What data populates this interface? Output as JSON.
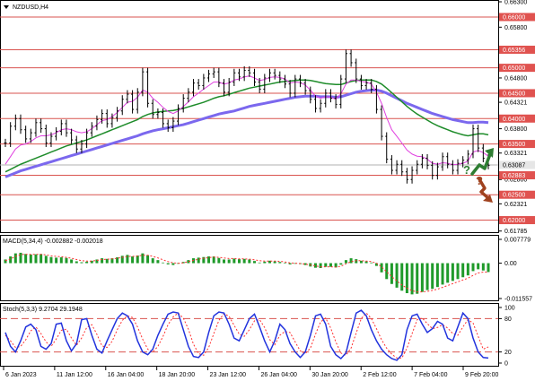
{
  "chart_data": [
    {
      "type": "line",
      "title": "NZDUSD,H4",
      "ylim": [
        0.6178,
        0.663
      ],
      "y_ticks": [
        "0.66300",
        "0.65800",
        "0.65356",
        "0.64800",
        "0.64321",
        "0.63800",
        "0.63321",
        "0.62800",
        "0.62321",
        "0.61785"
      ],
      "levels": [
        "0.66000",
        "0.65356",
        "0.65000",
        "0.64500",
        "0.64000",
        "0.63500",
        "0.62883",
        "0.62500",
        "0.62000"
      ],
      "current_price": "0.63087",
      "current_price_value": 0.63087,
      "x_labels": [
        "6 Jan 2023",
        "11 Jan 12:00",
        "16 Jan 04:00",
        "18 Jan 20:00",
        "23 Jan 12:00",
        "26 Jan 04:00",
        "30 Jan 20:00",
        "2 Feb 12:00",
        "7 Feb 04:00",
        "9 Feb 20:00"
      ],
      "series": [
        {
          "values": [
            0.6352,
            0.6385,
            0.64,
            0.6378,
            0.636,
            0.6372,
            0.6392,
            0.638,
            0.6352,
            0.6365,
            0.6375,
            0.639,
            0.6372,
            0.6358,
            0.634,
            0.635,
            0.6372,
            0.6385,
            0.6398,
            0.641,
            0.639,
            0.6402,
            0.6415,
            0.6438,
            0.6448,
            0.6418,
            0.6452,
            0.6492,
            0.643,
            0.6408,
            0.6412,
            0.639,
            0.6382,
            0.6395,
            0.642,
            0.644,
            0.6452,
            0.647,
            0.6465,
            0.648,
            0.6488,
            0.6492,
            0.647,
            0.6452,
            0.6472,
            0.649,
            0.6482,
            0.6495,
            0.649,
            0.6472,
            0.6458,
            0.648,
            0.649,
            0.6485,
            0.6478,
            0.6468,
            0.645,
            0.6478,
            0.647,
            0.6455,
            0.6438,
            0.642,
            0.643,
            0.645,
            0.644,
            0.6428,
            0.6478,
            0.6528,
            0.651,
            0.6478,
            0.6465,
            0.647,
            0.6458,
            0.6418,
            0.6365,
            0.632,
            0.6298,
            0.631,
            0.6295,
            0.628,
            0.6298,
            0.631,
            0.6322,
            0.6308,
            0.6288,
            0.6305,
            0.6325,
            0.631,
            0.6298,
            0.6312,
            0.6318,
            0.633,
            0.638,
            0.6342,
            0.6322,
            0.6308
          ]
        },
        {
          "values": [
            0.631,
            0.6325,
            0.634,
            0.6348,
            0.635,
            0.6355,
            0.6362,
            0.6366,
            0.6366,
            0.6368,
            0.6372,
            0.6378,
            0.638,
            0.6378,
            0.6374,
            0.6372,
            0.6374,
            0.638,
            0.6388,
            0.6396,
            0.6398,
            0.6404,
            0.6412,
            0.6422,
            0.6432,
            0.6434,
            0.6442,
            0.6456,
            0.6452,
            0.644,
            0.6432,
            0.6422,
            0.6414,
            0.641,
            0.6415,
            0.6424,
            0.6433,
            0.6443,
            0.645,
            0.6458,
            0.6465,
            0.6472,
            0.6472,
            0.6468,
            0.647,
            0.6476,
            0.6478,
            0.6482,
            0.6484,
            0.648,
            0.6475,
            0.6477,
            0.6481,
            0.6482,
            0.6481,
            0.6478,
            0.647,
            0.6472,
            0.6471,
            0.6466,
            0.6456,
            0.6444,
            0.644,
            0.6443,
            0.6442,
            0.6438,
            0.6449,
            0.6468,
            0.6476,
            0.6476,
            0.6473,
            0.6472,
            0.6468,
            0.6452,
            0.643,
            0.6402,
            0.6378,
            0.6365,
            0.6352,
            0.6338,
            0.633,
            0.6326,
            0.6325,
            0.632,
            0.6312,
            0.631,
            0.6313,
            0.6312,
            0.6309,
            0.631,
            0.6312,
            0.6316,
            0.6334,
            0.6337,
            0.6333,
            0.6326
          ]
        },
        {
          "values": [
            0.6295,
            0.63,
            0.6305,
            0.631,
            0.6314,
            0.6318,
            0.6322,
            0.6326,
            0.633,
            0.6334,
            0.6338,
            0.6342,
            0.6346,
            0.6349,
            0.6352,
            0.6355,
            0.6358,
            0.6362,
            0.6366,
            0.637,
            0.6374,
            0.6378,
            0.6382,
            0.6386,
            0.639,
            0.6394,
            0.6398,
            0.6404,
            0.6408,
            0.6411,
            0.6413,
            0.6414,
            0.6415,
            0.6416,
            0.6418,
            0.642,
            0.6423,
            0.6426,
            0.6429,
            0.6432,
            0.6436,
            0.644,
            0.6443,
            0.6445,
            0.6448,
            0.6451,
            0.6454,
            0.6457,
            0.646,
            0.6462,
            0.6464,
            0.6466,
            0.6468,
            0.647,
            0.6472,
            0.6473,
            0.6474,
            0.6475,
            0.6476,
            0.6476,
            0.6475,
            0.6473,
            0.6471,
            0.6469,
            0.6468,
            0.6467,
            0.6467,
            0.647,
            0.6473,
            0.6475,
            0.6476,
            0.6476,
            0.6476,
            0.6473,
            0.6468,
            0.646,
            0.6451,
            0.6442,
            0.6433,
            0.6424,
            0.6416,
            0.6409,
            0.6403,
            0.6397,
            0.6391,
            0.6386,
            0.6382,
            0.6378,
            0.6374,
            0.6371,
            0.6368,
            0.6366,
            0.6368,
            0.637,
            0.637,
            0.6368
          ]
        },
        {
          "values": [
            0.6285,
            0.6289,
            0.6293,
            0.6297,
            0.63,
            0.6303,
            0.6306,
            0.6309,
            0.6312,
            0.6315,
            0.6318,
            0.6321,
            0.6324,
            0.6327,
            0.633,
            0.6333,
            0.6336,
            0.6339,
            0.6342,
            0.6345,
            0.6348,
            0.6351,
            0.6354,
            0.6357,
            0.636,
            0.6363,
            0.6366,
            0.637,
            0.6373,
            0.6376,
            0.6378,
            0.638,
            0.6382,
            0.6384,
            0.6386,
            0.6388,
            0.6391,
            0.6394,
            0.6397,
            0.64,
            0.6403,
            0.6406,
            0.6409,
            0.6411,
            0.6413,
            0.6415,
            0.6418,
            0.6421,
            0.6424,
            0.6426,
            0.6428,
            0.643,
            0.6432,
            0.6434,
            0.6436,
            0.6438,
            0.644,
            0.6442,
            0.6443,
            0.6444,
            0.6444,
            0.6444,
            0.6443,
            0.6443,
            0.6443,
            0.6442,
            0.6443,
            0.6446,
            0.6449,
            0.6452,
            0.6454,
            0.6455,
            0.6456,
            0.6456,
            0.6454,
            0.645,
            0.6445,
            0.644,
            0.6435,
            0.643,
            0.6426,
            0.6422,
            0.6418,
            0.6414,
            0.641,
            0.6407,
            0.6404,
            0.6401,
            0.6398,
            0.6396,
            0.6394,
            0.6392,
            0.6392,
            0.6393,
            0.6393,
            0.6392
          ]
        }
      ]
    },
    {
      "type": "bar",
      "title": "MACD(5,34,4) -0.002882 -0.002018",
      "ylim": [
        -0.011557,
        0.007779
      ],
      "y_ticks": [
        "0.007779",
        "0.00",
        "-0.011557"
      ],
      "series": [
        {
          "values": [
            0.0012,
            0.0022,
            0.0032,
            0.0034,
            0.003,
            0.0028,
            0.0029,
            0.003,
            0.0024,
            0.002,
            0.0018,
            0.0019,
            0.0017,
            0.0012,
            0.0006,
            0.0003,
            0.0005,
            0.0008,
            0.0012,
            0.0016,
            0.0014,
            0.0016,
            0.0019,
            0.0024,
            0.0027,
            0.0022,
            0.0025,
            0.0032,
            0.0026,
            0.0016,
            0.001,
            0.0002,
            -0.0004,
            -0.0006,
            -0.0002,
            0.0004,
            0.001,
            0.0016,
            0.0018,
            0.002,
            0.0022,
            0.0022,
            0.0017,
            0.0012,
            0.0012,
            0.0015,
            0.0013,
            0.0014,
            0.0012,
            0.0007,
            0.0002,
            0.0005,
            0.0008,
            0.0006,
            0.0004,
            0.0001,
            -0.0004,
            -0.0002,
            -0.0003,
            -0.0006,
            -0.0011,
            -0.0015,
            -0.0016,
            -0.0012,
            -0.0012,
            -0.0014,
            -0.0005,
            0.001,
            0.0016,
            0.0013,
            0.0008,
            0.0006,
            0.0002,
            -0.0009,
            -0.003,
            -0.0052,
            -0.0068,
            -0.008,
            -0.009,
            -0.0098,
            -0.0102,
            -0.01,
            -0.0094,
            -0.0088,
            -0.0084,
            -0.0078,
            -0.007,
            -0.0064,
            -0.0058,
            -0.0052,
            -0.0046,
            -0.004,
            -0.0026,
            -0.002,
            -0.0024,
            -0.0029
          ]
        },
        {
          "values": [
            0.0008,
            0.0014,
            0.0022,
            0.0028,
            0.0029,
            0.0029,
            0.0029,
            0.0029,
            0.0027,
            0.0024,
            0.0022,
            0.0021,
            0.0019,
            0.0016,
            0.0012,
            0.0008,
            0.0007,
            0.0007,
            0.0009,
            0.0012,
            0.0013,
            0.0014,
            0.0016,
            0.0019,
            0.0022,
            0.0022,
            0.0023,
            0.0026,
            0.0026,
            0.0022,
            0.0017,
            0.0011,
            0.0005,
            0.0001,
            0.0,
            0.0001,
            0.0005,
            0.0009,
            0.0013,
            0.0016,
            0.0018,
            0.002,
            0.0019,
            0.0017,
            0.0015,
            0.0015,
            0.0014,
            0.0014,
            0.0013,
            0.0011,
            0.0008,
            0.0007,
            0.0007,
            0.0007,
            0.0006,
            0.0004,
            0.0001,
            0.0,
            -0.0001,
            -0.0003,
            -0.0006,
            -0.0009,
            -0.0012,
            -0.0012,
            -0.0012,
            -0.0013,
            -0.001,
            -0.0002,
            0.0005,
            0.0008,
            0.0008,
            0.0007,
            0.0005,
            0.0,
            -0.0012,
            -0.0028,
            -0.0044,
            -0.0058,
            -0.0071,
            -0.0082,
            -0.009,
            -0.0094,
            -0.0094,
            -0.0092,
            -0.0089,
            -0.0085,
            -0.0079,
            -0.0073,
            -0.0067,
            -0.0061,
            -0.0055,
            -0.0049,
            -0.004,
            -0.0032,
            -0.0029,
            -0.0029
          ]
        }
      ]
    },
    {
      "type": "line",
      "title": "Stoch(5,3,3) 9.2704 29.1948",
      "ylim": [
        0,
        100
      ],
      "y_ticks": [
        "100",
        "80",
        "20",
        "0"
      ],
      "series": [
        {
          "values": [
            55,
            30,
            20,
            40,
            65,
            70,
            60,
            30,
            25,
            35,
            70,
            72,
            40,
            22,
            35,
            78,
            80,
            50,
            25,
            18,
            40,
            60,
            80,
            90,
            85,
            70,
            40,
            20,
            15,
            25,
            50,
            70,
            88,
            92,
            90,
            60,
            30,
            12,
            10,
            20,
            55,
            85,
            92,
            90,
            70,
            45,
            40,
            60,
            80,
            88,
            65,
            40,
            20,
            40,
            70,
            60,
            35,
            20,
            10,
            20,
            50,
            85,
            88,
            70,
            30,
            15,
            8,
            18,
            55,
            90,
            95,
            85,
            60,
            40,
            25,
            15,
            8,
            5,
            15,
            60,
            85,
            88,
            70,
            55,
            62,
            75,
            70,
            45,
            40,
            65,
            90,
            80,
            45,
            20,
            10,
            9
          ]
        },
        {
          "values": [
            50,
            40,
            28,
            30,
            42,
            58,
            65,
            53,
            38,
            30,
            43,
            59,
            61,
            45,
            32,
            45,
            64,
            69,
            52,
            31,
            28,
            39,
            60,
            77,
            85,
            82,
            65,
            43,
            25,
            20,
            30,
            48,
            69,
            83,
            90,
            81,
            61,
            34,
            17,
            14,
            28,
            53,
            77,
            89,
            84,
            68,
            52,
            48,
            60,
            76,
            78,
            64,
            42,
            33,
            50,
            57,
            55,
            38,
            22,
            17,
            27,
            52,
            74,
            81,
            63,
            38,
            18,
            14,
            27,
            54,
            80,
            90,
            80,
            62,
            42,
            27,
            16,
            9,
            9,
            27,
            53,
            78,
            81,
            71,
            62,
            64,
            69,
            63,
            53,
            50,
            65,
            78,
            72,
            48,
            25,
            29
          ]
        }
      ]
    }
  ]
}
